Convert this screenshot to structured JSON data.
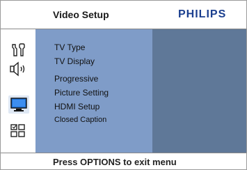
{
  "header": {
    "title": "Video Setup",
    "brand": "PHILIPS"
  },
  "sidebar": {
    "icons": [
      {
        "name": "general-setup-icon"
      },
      {
        "name": "audio-setup-icon"
      },
      {
        "name": "video-setup-icon",
        "selected": true
      },
      {
        "name": "preference-setup-icon"
      }
    ]
  },
  "menu": {
    "items": [
      {
        "label": "TV Type"
      },
      {
        "label": "TV Display"
      },
      {
        "label": "Progressive"
      },
      {
        "label": "Picture Setting"
      },
      {
        "label": "HDMI Setup"
      },
      {
        "label": "Closed Caption"
      }
    ]
  },
  "footer": {
    "hint": "Press OPTIONS to exit menu"
  },
  "colors": {
    "menu_panel": "#7f9cc8",
    "sub_panel": "#5f7898",
    "brand": "#1b3f8f"
  }
}
